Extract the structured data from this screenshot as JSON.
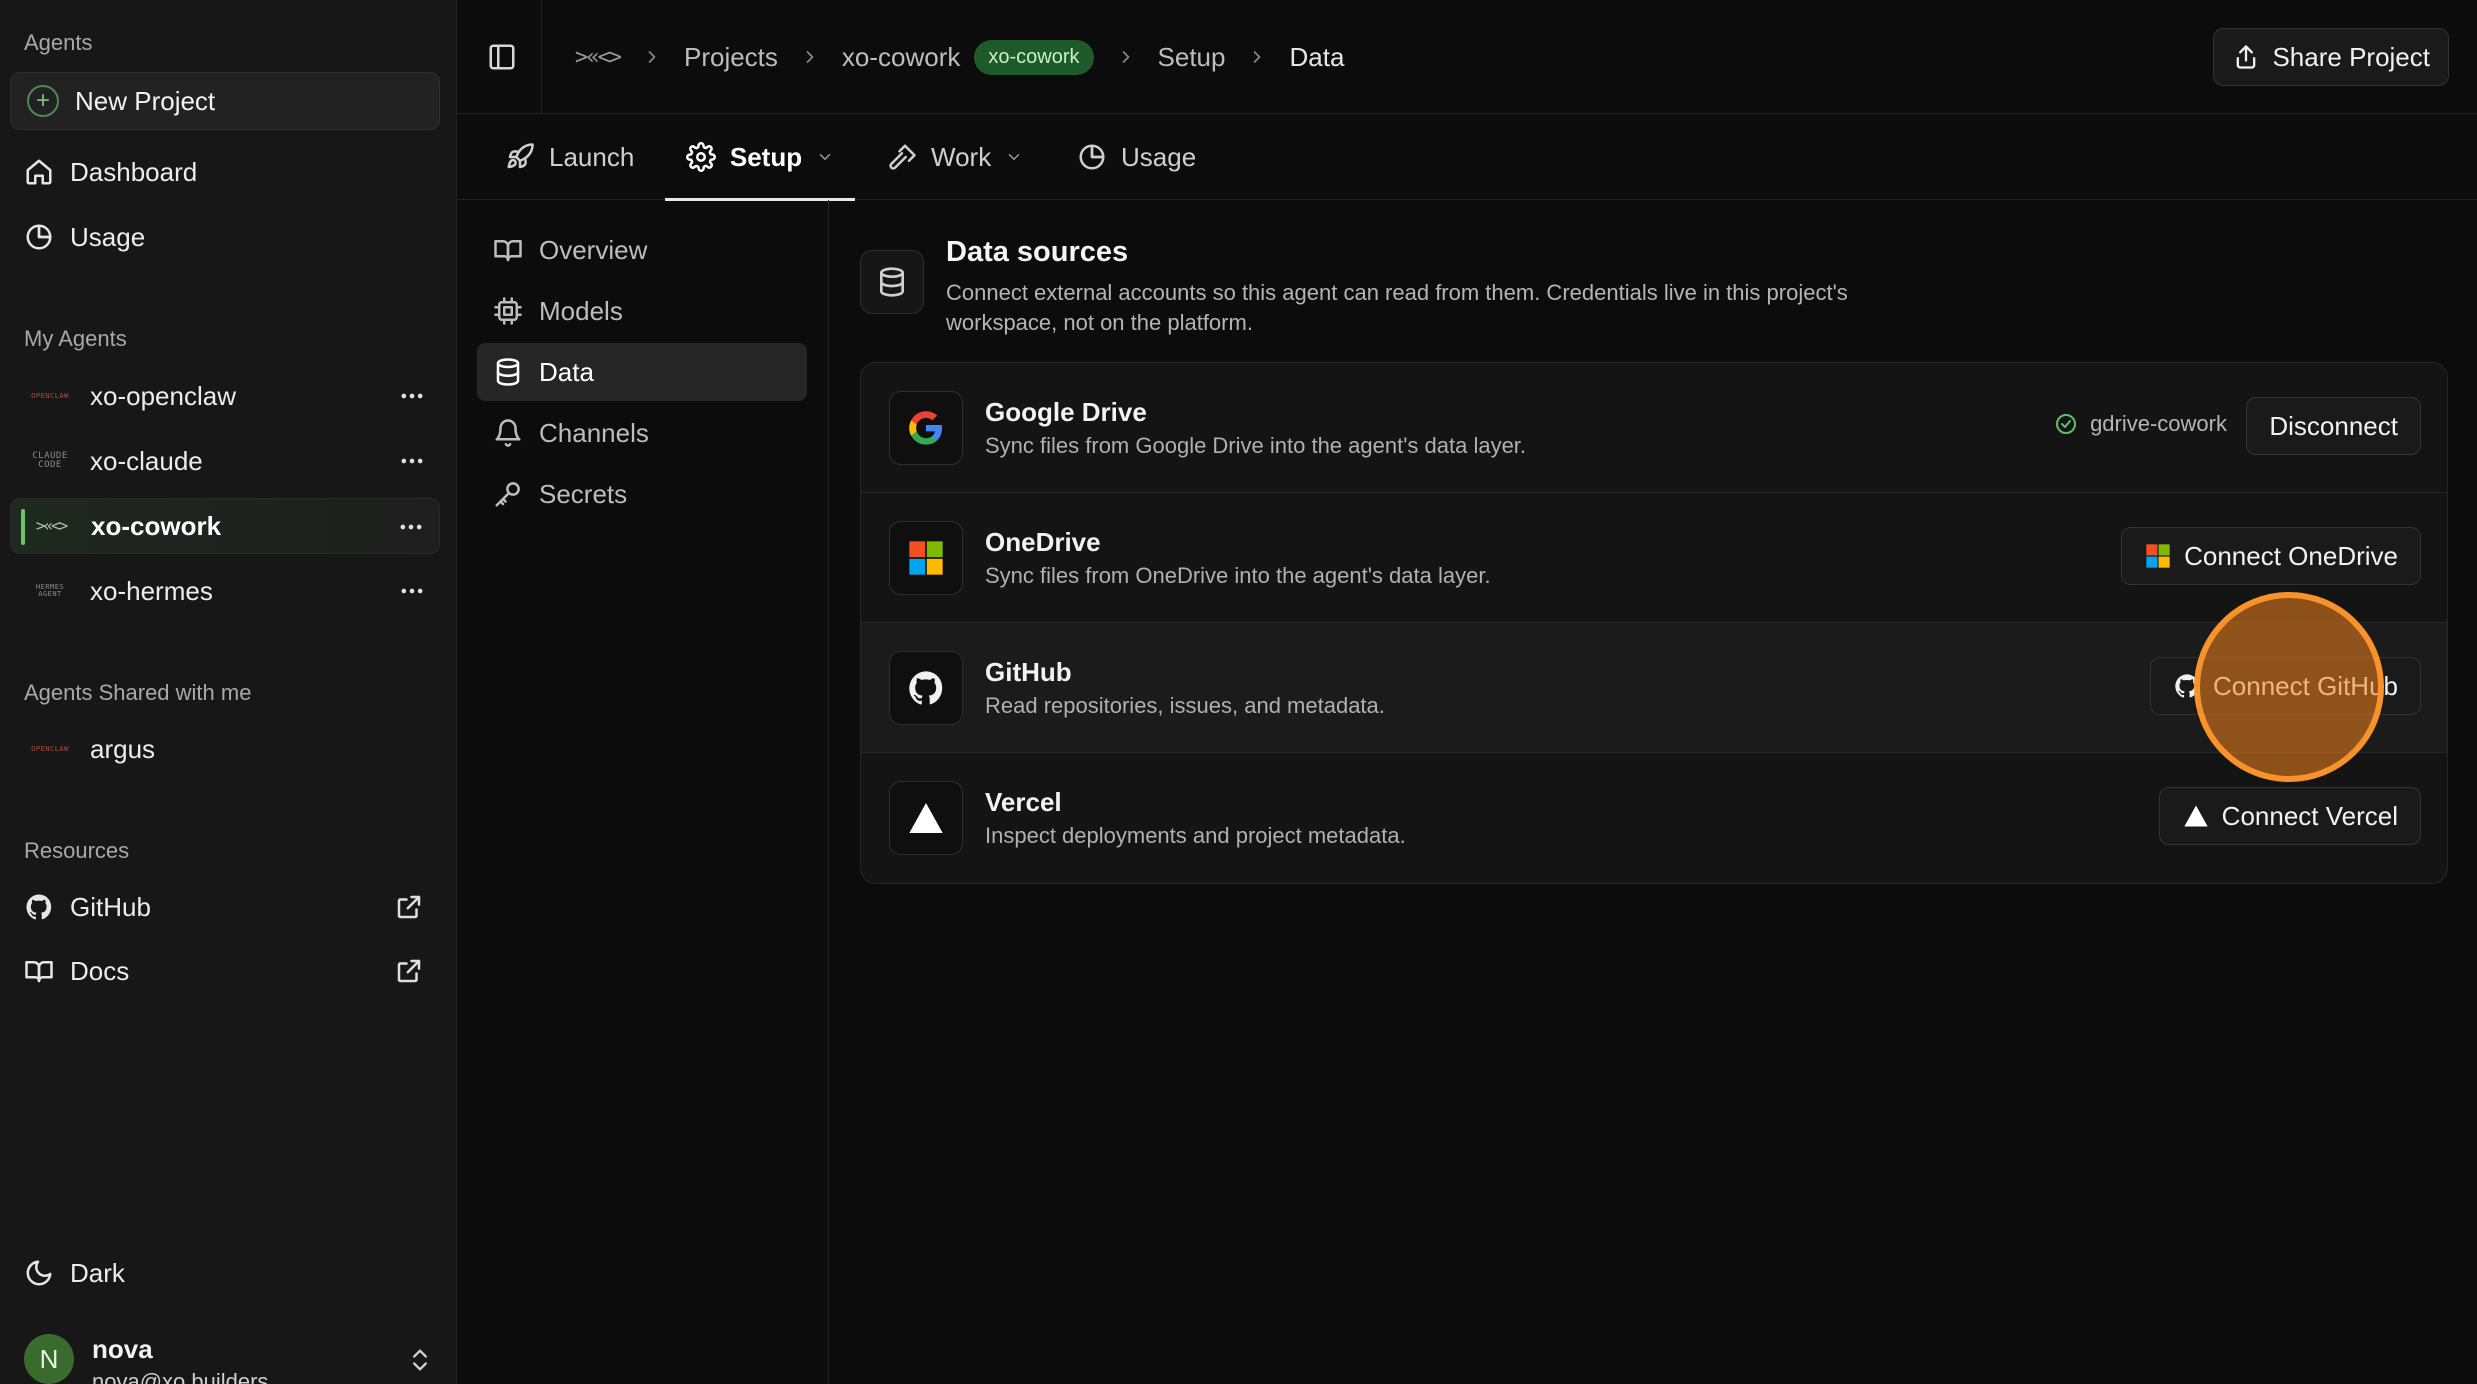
{
  "sidebar": {
    "sections": {
      "agents": "Agents",
      "my_agents": "My Agents",
      "shared": "Agents Shared with me",
      "resources": "Resources"
    },
    "new_project": "New Project",
    "nav": [
      {
        "label": "Dashboard",
        "icon": "home-icon"
      },
      {
        "label": "Usage",
        "icon": "pie-chart-icon"
      }
    ],
    "my_agents": [
      {
        "label": "xo-openclaw",
        "logo": "OPENCLAW"
      },
      {
        "label": "xo-claude",
        "logo": "CLAUDE CODE"
      },
      {
        "label": "xo-cowork",
        "logo": ">«<>",
        "active": true
      },
      {
        "label": "xo-hermes",
        "logo": "HERMES AGENT"
      }
    ],
    "shared_agents": [
      {
        "label": "argus",
        "logo": "OPENCLAW"
      }
    ],
    "resources": [
      {
        "label": "GitHub",
        "icon": "github-icon"
      },
      {
        "label": "Docs",
        "icon": "book-icon"
      }
    ],
    "theme_label": "Dark",
    "user": {
      "initial": "N",
      "name": "nova",
      "email": "nova@xo.builders"
    }
  },
  "header": {
    "logo": ">«<>",
    "breadcrumbs": [
      "Projects",
      "xo-cowork",
      "Setup",
      "Data"
    ],
    "badge": "xo-cowork",
    "share_label": "Share Project"
  },
  "tabs": [
    {
      "label": "Launch",
      "icon": "rocket-icon"
    },
    {
      "label": "Setup",
      "icon": "gear-icon",
      "active": true,
      "dropdown": true
    },
    {
      "label": "Work",
      "icon": "hammer-icon",
      "dropdown": true
    },
    {
      "label": "Usage",
      "icon": "pie-chart-icon"
    }
  ],
  "subnav": [
    {
      "label": "Overview",
      "icon": "book-open-icon"
    },
    {
      "label": "Models",
      "icon": "chip-icon"
    },
    {
      "label": "Data",
      "icon": "database-icon",
      "active": true
    },
    {
      "label": "Channels",
      "icon": "bell-icon"
    },
    {
      "label": "Secrets",
      "icon": "key-icon"
    }
  ],
  "main": {
    "title": "Data sources",
    "description": "Connect external accounts so this agent can read from them. Credentials live in this project's workspace, not on the platform.",
    "sources": [
      {
        "name": "Google Drive",
        "description": "Sync files from Google Drive into the agent's data layer.",
        "status": "gdrive-cowork",
        "action": "Disconnect",
        "connected": true
      },
      {
        "name": "OneDrive",
        "description": "Sync files from OneDrive into the agent's data layer.",
        "action": "Connect OneDrive"
      },
      {
        "name": "GitHub",
        "description": "Read repositories, issues, and metadata.",
        "action": "Connect GitHub"
      },
      {
        "name": "Vercel",
        "description": "Inspect deployments and project metadata.",
        "action": "Connect Vercel"
      }
    ]
  },
  "colors": {
    "accent_green": "#6bc46b",
    "badge_bg": "#1e5a2a",
    "click_highlight": "#f7932a",
    "background": "#0c0c0c",
    "sidebar": "#171717"
  }
}
